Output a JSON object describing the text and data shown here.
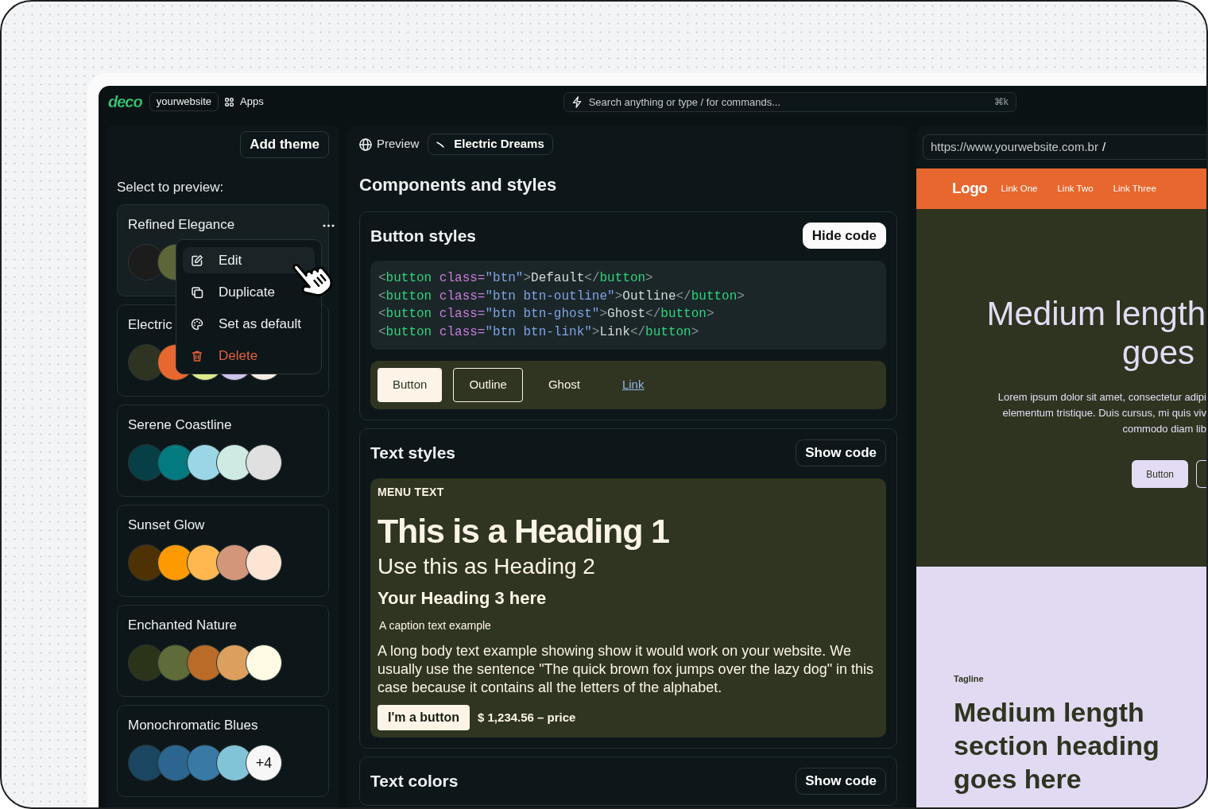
{
  "topbar": {
    "logo": "deco",
    "site": "yourwebsite",
    "apps": "Apps",
    "search": {
      "placeholder": "Search anything or type / for commands...",
      "shortcut": "⌘k"
    }
  },
  "themes_panel": {
    "add_button": "Add theme",
    "prompt": "Select to preview:",
    "themes": [
      {
        "name": "Refined Elegance",
        "selected": true,
        "swatches": [
          {
            "color": "#1c1c1c"
          },
          {
            "color": "#5c6638"
          }
        ]
      },
      {
        "name": "Electric",
        "selected": false,
        "swatches": [
          {
            "color": "#2e3421"
          },
          {
            "color": "#e8672e"
          },
          {
            "color": "#dbe98a"
          },
          {
            "color": "#cdc3ef"
          },
          {
            "color": "#f6ece2"
          }
        ]
      },
      {
        "name": "Serene Coastline",
        "selected": false,
        "swatches": [
          {
            "color": "#063f46"
          },
          {
            "color": "#027a80"
          },
          {
            "color": "#9bd6e6"
          },
          {
            "color": "#cfe9e3"
          },
          {
            "color": "#e0e0e0"
          }
        ]
      },
      {
        "name": "Sunset Glow",
        "selected": false,
        "swatches": [
          {
            "color": "#4f3203"
          },
          {
            "color": "#fd9a02"
          },
          {
            "color": "#feb84f"
          },
          {
            "color": "#d3967a"
          },
          {
            "color": "#fde5d4"
          }
        ]
      },
      {
        "name": "Enchanted Nature",
        "selected": false,
        "swatches": [
          {
            "color": "#2b3419"
          },
          {
            "color": "#5f6b38"
          },
          {
            "color": "#b96b27"
          },
          {
            "color": "#dc9f5d"
          },
          {
            "color": "#fefae4"
          }
        ]
      },
      {
        "name": "Monochromatic Blues",
        "selected": false,
        "swatches": [
          {
            "color": "#1a4661"
          },
          {
            "color": "#2b6590"
          },
          {
            "color": "#3879a6"
          },
          {
            "color": "#82c4d7"
          }
        ],
        "more": "+4"
      }
    ],
    "context_menu": {
      "items": [
        {
          "kind": "edit",
          "label": "Edit",
          "selected": true
        },
        {
          "kind": "duplicate",
          "label": "Duplicate",
          "selected": false
        },
        {
          "kind": "default",
          "label": "Set as default",
          "selected": false
        },
        {
          "kind": "delete",
          "label": "Delete",
          "selected": false
        }
      ]
    }
  },
  "preview_panel": {
    "label": "Preview",
    "theme": "Electric Dreams",
    "title": "Components and styles",
    "sections": [
      {
        "kind": "buttons",
        "title": "Button styles",
        "code_button": "Hide code",
        "code_shown": true,
        "code": [
          [
            {
              "kind": "punct",
              "text": "<"
            },
            {
              "kind": "tag",
              "text": "button"
            },
            {
              "kind": "attr",
              "text": " class="
            },
            {
              "kind": "string",
              "text": "\"btn\""
            },
            {
              "kind": "punct",
              "text": ">"
            },
            {
              "kind": "text",
              "text": "Default"
            },
            {
              "kind": "punct",
              "text": "</"
            },
            {
              "kind": "tag",
              "text": "button"
            },
            {
              "kind": "punct",
              "text": ">"
            }
          ],
          [
            {
              "kind": "punct",
              "text": "<"
            },
            {
              "kind": "tag",
              "text": "button"
            },
            {
              "kind": "attr",
              "text": " class="
            },
            {
              "kind": "string",
              "text": "\"btn btn-outline\""
            },
            {
              "kind": "punct",
              "text": ">"
            },
            {
              "kind": "text",
              "text": "Outline"
            },
            {
              "kind": "punct",
              "text": "</"
            },
            {
              "kind": "tag",
              "text": "button"
            },
            {
              "kind": "punct",
              "text": ">"
            }
          ],
          [
            {
              "kind": "punct",
              "text": "<"
            },
            {
              "kind": "tag",
              "text": "button"
            },
            {
              "kind": "attr",
              "text": " class="
            },
            {
              "kind": "string",
              "text": "\"btn btn-ghost\""
            },
            {
              "kind": "punct",
              "text": ">"
            },
            {
              "kind": "text",
              "text": "Ghost"
            },
            {
              "kind": "punct",
              "text": "</"
            },
            {
              "kind": "tag",
              "text": "button"
            },
            {
              "kind": "punct",
              "text": ">"
            }
          ],
          [
            {
              "kind": "punct",
              "text": "<"
            },
            {
              "kind": "tag",
              "text": "button"
            },
            {
              "kind": "attr",
              "text": " class="
            },
            {
              "kind": "string",
              "text": "\"btn btn-link\""
            },
            {
              "kind": "punct",
              "text": ">"
            },
            {
              "kind": "text",
              "text": "Link"
            },
            {
              "kind": "punct",
              "text": "</"
            },
            {
              "kind": "tag",
              "text": "button"
            },
            {
              "kind": "punct",
              "text": ">"
            }
          ]
        ],
        "buttons": [
          {
            "kind": "default",
            "label": "Button"
          },
          {
            "kind": "outline",
            "label": "Outline"
          },
          {
            "kind": "ghost",
            "label": "Ghost"
          },
          {
            "kind": "link",
            "label": "Link"
          }
        ]
      },
      {
        "kind": "text",
        "title": "Text styles",
        "code_button": "Show code",
        "code_shown": false,
        "styles": [
          {
            "kind": "menu",
            "text": "MENU TEXT"
          },
          {
            "kind": "h1",
            "text": "This is a Heading 1"
          },
          {
            "kind": "h2",
            "text": "Use this as Heading 2"
          },
          {
            "kind": "h3",
            "text": "Your Heading 3 here"
          },
          {
            "kind": "caption",
            "text": "A caption text example"
          },
          {
            "kind": "body",
            "text": "A long body text example showing show it would work on your website. We usually use the sentence \"The quick brown fox jumps over the lazy dog\" in this case because it contains all the letters of the alphabet."
          }
        ],
        "button": "I'm a button",
        "price": "$ 1,234.56 – price"
      },
      {
        "kind": "colors",
        "title": "Text colors",
        "code_button": "Show code",
        "code_shown": false
      }
    ]
  },
  "site_panel": {
    "url": "https://www.yourwebsite.com.br",
    "path": "/",
    "site": {
      "logo": "Logo",
      "links": [
        "Link One",
        "Link Two",
        "Link Three"
      ],
      "hero": {
        "heading_lines": [
          "Medium length",
          "goes"
        ],
        "body_lines": [
          "Lorem ipsum dolor sit amet, consectetur adipi",
          "elementum tristique. Duis cursus, mi quis viv",
          "commodo diam lib"
        ],
        "buttons": [
          {
            "kind": "solid",
            "label": "Button"
          },
          {
            "kind": "outline"
          }
        ]
      },
      "section": {
        "tagline": "Tagline",
        "heading": "Medium length section heading goes here"
      }
    }
  }
}
